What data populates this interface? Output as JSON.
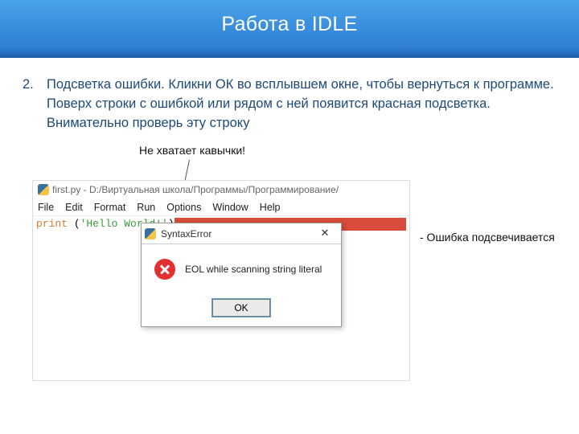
{
  "slide": {
    "title": "Работа в IDLE",
    "step_num": "2.",
    "step_text": "Подсветка ошибки. Кликни ОК во всплывшем окне, чтобы вернуться к программе. Поверх строки с ошибкой или рядом с ней появится красная подсветка. Внимательно проверь эту строку",
    "callout": "Не хватает кавычки!",
    "side_note": "- Ошибка подсвечивается"
  },
  "editor": {
    "title": "first.py - D:/Виртуальная школа/Программы/Программирование/",
    "menu": [
      "File",
      "Edit",
      "Format",
      "Run",
      "Options",
      "Window",
      "Help"
    ],
    "code": {
      "func": "print ",
      "paren_open": "(",
      "string": "'Hello World!'",
      "paren_close": ")"
    }
  },
  "dialog": {
    "title": "SyntaxError",
    "message": "EOL while scanning string literal",
    "ok": "OK",
    "close_glyph": "✕"
  }
}
